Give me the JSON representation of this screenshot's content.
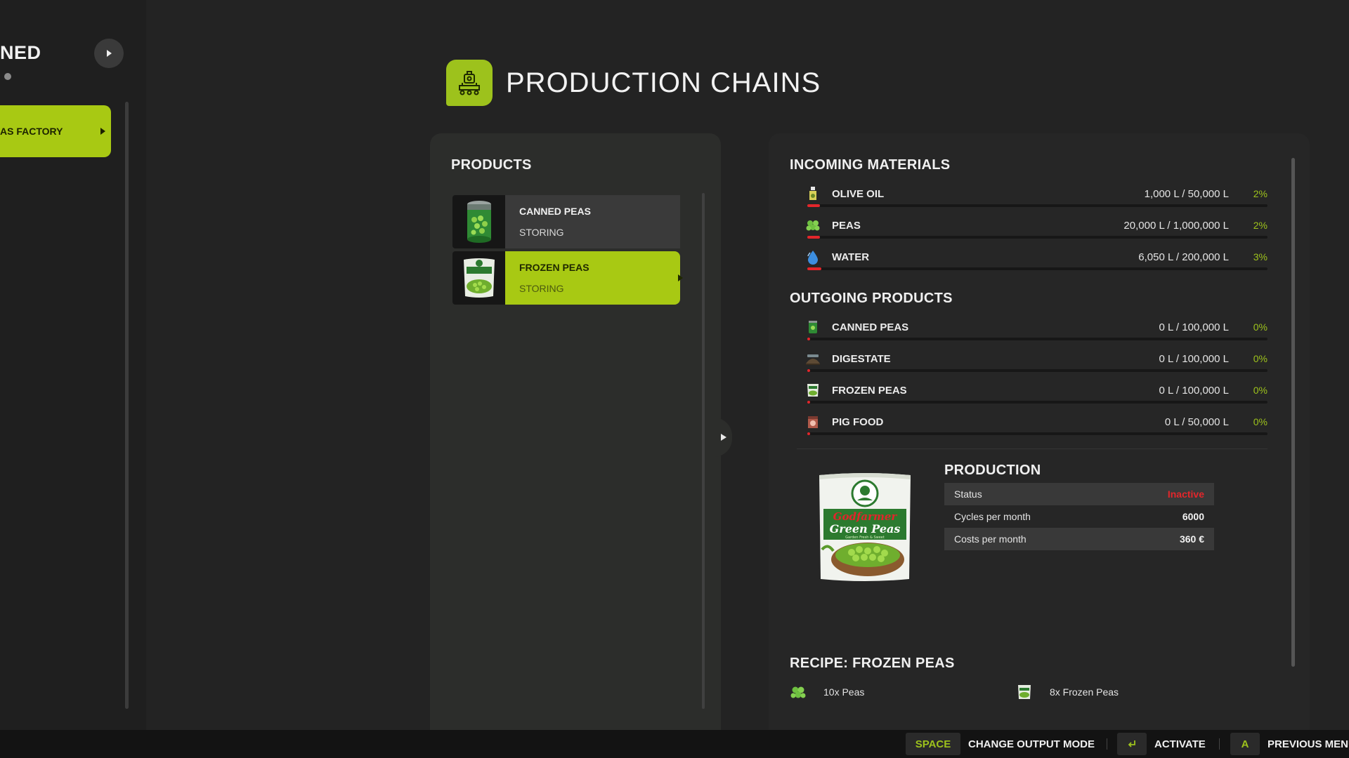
{
  "sidebar": {
    "title_fragment": "NED",
    "active_item_label": "AS FACTORY"
  },
  "header": {
    "title": "PRODUCTION CHAINS",
    "icon": "factory-icon"
  },
  "products": {
    "heading": "PRODUCTS",
    "items": [
      {
        "name": "CANNED PEAS",
        "status": "STORING",
        "icon": "canned-peas-icon",
        "selected": false
      },
      {
        "name": "FROZEN PEAS",
        "status": "STORING",
        "icon": "frozen-peas-icon",
        "selected": true
      }
    ]
  },
  "incoming": {
    "heading": "INCOMING MATERIALS",
    "items": [
      {
        "name": "OLIVE OIL",
        "amount": "1,000 L / 50,000 L",
        "percent": "2%",
        "fill": 0.02,
        "icon": "olive-oil-icon"
      },
      {
        "name": "PEAS",
        "amount": "20,000 L / 1,000,000 L",
        "percent": "2%",
        "fill": 0.02,
        "icon": "peas-icon"
      },
      {
        "name": "WATER",
        "amount": "6,050 L / 200,000 L",
        "percent": "3%",
        "fill": 0.03,
        "icon": "water-drop-icon"
      }
    ]
  },
  "outgoing": {
    "heading": "OUTGOING PRODUCTS",
    "items": [
      {
        "name": "CANNED PEAS",
        "amount": "0 L / 100,000 L",
        "percent": "0%",
        "fill": 0.0,
        "icon": "canned-peas-icon"
      },
      {
        "name": "DIGESTATE",
        "amount": "0 L / 100,000 L",
        "percent": "0%",
        "fill": 0.0,
        "icon": "digestate-icon"
      },
      {
        "name": "FROZEN PEAS",
        "amount": "0 L / 100,000 L",
        "percent": "0%",
        "fill": 0.0,
        "icon": "frozen-peas-icon"
      },
      {
        "name": "PIG FOOD",
        "amount": "0 L / 50,000 L",
        "percent": "0%",
        "fill": 0.0,
        "icon": "pig-food-icon"
      }
    ]
  },
  "production": {
    "heading": "PRODUCTION",
    "image_brand": "Godfarmer",
    "image_product": "Green Peas",
    "image_tagline": "Garden Fresh & Sweet",
    "rows": [
      {
        "label": "Status",
        "value": "Inactive"
      },
      {
        "label": "Cycles per month",
        "value": "6000"
      },
      {
        "label": "Costs per month",
        "value": "360 €"
      }
    ]
  },
  "recipe": {
    "heading": "RECIPE: FROZEN PEAS",
    "input": {
      "text": "10x Peas",
      "icon": "peas-icon"
    },
    "output": {
      "text": "8x Frozen Peas",
      "icon": "frozen-peas-icon"
    }
  },
  "footer": {
    "hints": [
      {
        "key": "SPACE",
        "label": "CHANGE OUTPUT MODE"
      },
      {
        "key": "enter-icon",
        "label": "ACTIVATE"
      },
      {
        "key": "A",
        "label": "PREVIOUS MENU"
      }
    ]
  },
  "colors": {
    "accent": "#a8c913",
    "alert": "#e3262b",
    "background": "#232323"
  }
}
